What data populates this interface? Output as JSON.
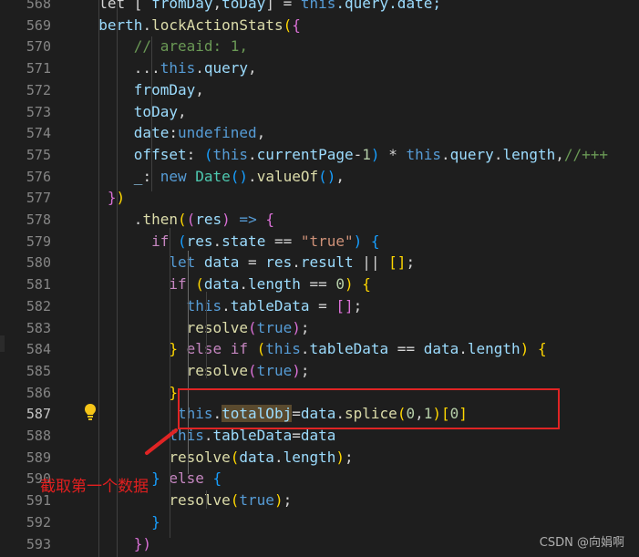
{
  "editor": {
    "lines": [
      {
        "n": "568",
        "segs": [
          [
            "  let [ ",
            "#d4d4d4"
          ],
          [
            "fromDay",
            "#9cdcfe"
          ],
          [
            ",",
            "#d4d4d4"
          ],
          [
            "toDay",
            "#9cdcfe"
          ],
          [
            "] = ",
            "#d4d4d4"
          ],
          [
            "this",
            "#569cd6"
          ],
          [
            ".query.date;",
            "#9cdcfe"
          ]
        ]
      },
      {
        "n": "569",
        "segs": [
          [
            "  berth",
            "#9cdcfe"
          ],
          [
            ".",
            "#d4d4d4"
          ],
          [
            "lockActionStats",
            "#dcdcaa"
          ],
          [
            "(",
            "#ffd700"
          ],
          [
            "{",
            "#da70d6"
          ]
        ]
      },
      {
        "n": "570",
        "segs": [
          [
            "      // areaid: 1,",
            "#6a9955"
          ]
        ]
      },
      {
        "n": "571",
        "segs": [
          [
            "      ...",
            "#d4d4d4"
          ],
          [
            "this",
            "#569cd6"
          ],
          [
            ".",
            "#d4d4d4"
          ],
          [
            "query",
            "#9cdcfe"
          ],
          [
            ",",
            "#d4d4d4"
          ]
        ]
      },
      {
        "n": "572",
        "segs": [
          [
            "      fromDay",
            "#9cdcfe"
          ],
          [
            ",",
            "#d4d4d4"
          ]
        ]
      },
      {
        "n": "573",
        "segs": [
          [
            "      toDay",
            "#9cdcfe"
          ],
          [
            ",",
            "#d4d4d4"
          ]
        ]
      },
      {
        "n": "574",
        "segs": [
          [
            "      date",
            "#9cdcfe"
          ],
          [
            ":",
            "#d4d4d4"
          ],
          [
            "undefined",
            "#569cd6"
          ],
          [
            ",",
            "#d4d4d4"
          ]
        ]
      },
      {
        "n": "575",
        "segs": [
          [
            "      offset",
            "#9cdcfe"
          ],
          [
            ": ",
            "#d4d4d4"
          ],
          [
            "(",
            "#179fff"
          ],
          [
            "this",
            "#569cd6"
          ],
          [
            ".",
            "#d4d4d4"
          ],
          [
            "currentPage",
            "#9cdcfe"
          ],
          [
            "-",
            "#d4d4d4"
          ],
          [
            "1",
            "#b5cea8"
          ],
          [
            ")",
            "#179fff"
          ],
          [
            " * ",
            "#d4d4d4"
          ],
          [
            "this",
            "#569cd6"
          ],
          [
            ".",
            "#d4d4d4"
          ],
          [
            "query",
            "#9cdcfe"
          ],
          [
            ".",
            "#d4d4d4"
          ],
          [
            "length",
            "#9cdcfe"
          ],
          [
            ",",
            "#d4d4d4"
          ],
          [
            "//+++",
            "#6a9955"
          ]
        ]
      },
      {
        "n": "576",
        "segs": [
          [
            "      _",
            "#9cdcfe"
          ],
          [
            ": ",
            "#d4d4d4"
          ],
          [
            "new ",
            "#569cd6"
          ],
          [
            "Date",
            "#4ec9b0"
          ],
          [
            "(",
            "#179fff"
          ],
          [
            ")",
            "#179fff"
          ],
          [
            ".",
            "#d4d4d4"
          ],
          [
            "valueOf",
            "#dcdcaa"
          ],
          [
            "(",
            "#179fff"
          ],
          [
            ")",
            "#179fff"
          ],
          [
            ",",
            "#d4d4d4"
          ]
        ]
      },
      {
        "n": "577",
        "segs": [
          [
            "   ",
            "#d4d4d4"
          ],
          [
            "}",
            "#da70d6"
          ],
          [
            ")",
            "#ffd700"
          ]
        ]
      },
      {
        "n": "578",
        "segs": [
          [
            "      .",
            "#d4d4d4"
          ],
          [
            "then",
            "#dcdcaa"
          ],
          [
            "(",
            "#ffd700"
          ],
          [
            "(",
            "#da70d6"
          ],
          [
            "res",
            "#9cdcfe"
          ],
          [
            ")",
            "#da70d6"
          ],
          [
            " => ",
            "#569cd6"
          ],
          [
            "{",
            "#da70d6"
          ]
        ]
      },
      {
        "n": "579",
        "segs": [
          [
            "        if ",
            "#c586c0"
          ],
          [
            "(",
            "#179fff"
          ],
          [
            "res",
            "#9cdcfe"
          ],
          [
            ".",
            "#d4d4d4"
          ],
          [
            "state",
            "#9cdcfe"
          ],
          [
            " == ",
            "#d4d4d4"
          ],
          [
            "\"true\"",
            "#ce9178"
          ],
          [
            ")",
            "#179fff"
          ],
          [
            " {",
            "#179fff"
          ]
        ]
      },
      {
        "n": "580",
        "segs": [
          [
            "          let ",
            "#569cd6"
          ],
          [
            "data",
            "#9cdcfe"
          ],
          [
            " = ",
            "#d4d4d4"
          ],
          [
            "res",
            "#9cdcfe"
          ],
          [
            ".",
            "#d4d4d4"
          ],
          [
            "result",
            "#9cdcfe"
          ],
          [
            " || ",
            "#d4d4d4"
          ],
          [
            "[]",
            "#ffd700"
          ],
          [
            ";",
            "#d4d4d4"
          ]
        ]
      },
      {
        "n": "581",
        "segs": [
          [
            "          if ",
            "#c586c0"
          ],
          [
            "(",
            "#ffd700"
          ],
          [
            "data",
            "#9cdcfe"
          ],
          [
            ".",
            "#d4d4d4"
          ],
          [
            "length",
            "#9cdcfe"
          ],
          [
            " == ",
            "#d4d4d4"
          ],
          [
            "0",
            "#b5cea8"
          ],
          [
            ")",
            "#ffd700"
          ],
          [
            " {",
            "#ffd700"
          ]
        ]
      },
      {
        "n": "582",
        "segs": [
          [
            "            this",
            "#569cd6"
          ],
          [
            ".",
            "#d4d4d4"
          ],
          [
            "tableData",
            "#9cdcfe"
          ],
          [
            " = ",
            "#d4d4d4"
          ],
          [
            "[]",
            "#da70d6"
          ],
          [
            ";",
            "#d4d4d4"
          ]
        ]
      },
      {
        "n": "583",
        "segs": [
          [
            "            resolve",
            "#dcdcaa"
          ],
          [
            "(",
            "#da70d6"
          ],
          [
            "true",
            "#569cd6"
          ],
          [
            ")",
            "#da70d6"
          ],
          [
            ";",
            "#d4d4d4"
          ]
        ]
      },
      {
        "n": "584",
        "segs": [
          [
            "          } ",
            "#ffd700"
          ],
          [
            "else if ",
            "#c586c0"
          ],
          [
            "(",
            "#ffd700"
          ],
          [
            "this",
            "#569cd6"
          ],
          [
            ".",
            "#d4d4d4"
          ],
          [
            "tableData",
            "#9cdcfe"
          ],
          [
            " == ",
            "#d4d4d4"
          ],
          [
            "data",
            "#9cdcfe"
          ],
          [
            ".",
            "#d4d4d4"
          ],
          [
            "length",
            "#9cdcfe"
          ],
          [
            ")",
            "#ffd700"
          ],
          [
            " {",
            "#ffd700"
          ]
        ]
      },
      {
        "n": "585",
        "segs": [
          [
            "            resolve",
            "#dcdcaa"
          ],
          [
            "(",
            "#da70d6"
          ],
          [
            "true",
            "#569cd6"
          ],
          [
            ")",
            "#da70d6"
          ],
          [
            ";",
            "#d4d4d4"
          ]
        ]
      },
      {
        "n": "586",
        "segs": [
          [
            "          }",
            "#ffd700"
          ]
        ]
      },
      {
        "n": "587",
        "segs": [
          [
            "           this",
            "#569cd6"
          ],
          [
            ".",
            "#d4d4d4"
          ],
          [
            "totalObj",
            "#9cdcfe",
            "sel"
          ],
          [
            "=",
            "#d4d4d4"
          ],
          [
            "data",
            "#9cdcfe"
          ],
          [
            ".",
            "#d4d4d4"
          ],
          [
            "splice",
            "#dcdcaa"
          ],
          [
            "(",
            "#ffd700"
          ],
          [
            "0",
            "#b5cea8"
          ],
          [
            ",",
            "#d4d4d4"
          ],
          [
            "1",
            "#b5cea8"
          ],
          [
            ")",
            "#ffd700"
          ],
          [
            "[",
            "#ffd700"
          ],
          [
            "0",
            "#b5cea8"
          ],
          [
            "]",
            "#ffd700"
          ]
        ]
      },
      {
        "n": "588",
        "segs": [
          [
            "          this",
            "#569cd6"
          ],
          [
            ".",
            "#d4d4d4"
          ],
          [
            "tableData",
            "#9cdcfe"
          ],
          [
            "=",
            "#d4d4d4"
          ],
          [
            "data",
            "#9cdcfe"
          ]
        ]
      },
      {
        "n": "589",
        "segs": [
          [
            "          resolve",
            "#dcdcaa"
          ],
          [
            "(",
            "#ffd700"
          ],
          [
            "data",
            "#9cdcfe"
          ],
          [
            ".",
            "#d4d4d4"
          ],
          [
            "length",
            "#9cdcfe"
          ],
          [
            ")",
            "#ffd700"
          ],
          [
            ";",
            "#d4d4d4"
          ]
        ]
      },
      {
        "n": "590",
        "segs": [
          [
            "        } ",
            "#179fff"
          ],
          [
            "else ",
            "#c586c0"
          ],
          [
            "{",
            "#179fff"
          ]
        ]
      },
      {
        "n": "591",
        "segs": [
          [
            "          resolve",
            "#dcdcaa"
          ],
          [
            "(",
            "#ffd700"
          ],
          [
            "true",
            "#569cd6"
          ],
          [
            ")",
            "#ffd700"
          ],
          [
            ";",
            "#d4d4d4"
          ]
        ]
      },
      {
        "n": "592",
        "segs": [
          [
            "        }",
            "#179fff"
          ]
        ]
      },
      {
        "n": "593",
        "segs": [
          [
            "      })",
            "#da70d6"
          ]
        ]
      }
    ],
    "active_line": "587",
    "annotation": "截取第一个数据",
    "watermark": "CSDN @向娟啊",
    "lightbulb_icon": "lightbulb-icon"
  },
  "colors": {
    "background": "#1e1e1e",
    "highlight": "#e02424",
    "line_number": "#858585"
  }
}
